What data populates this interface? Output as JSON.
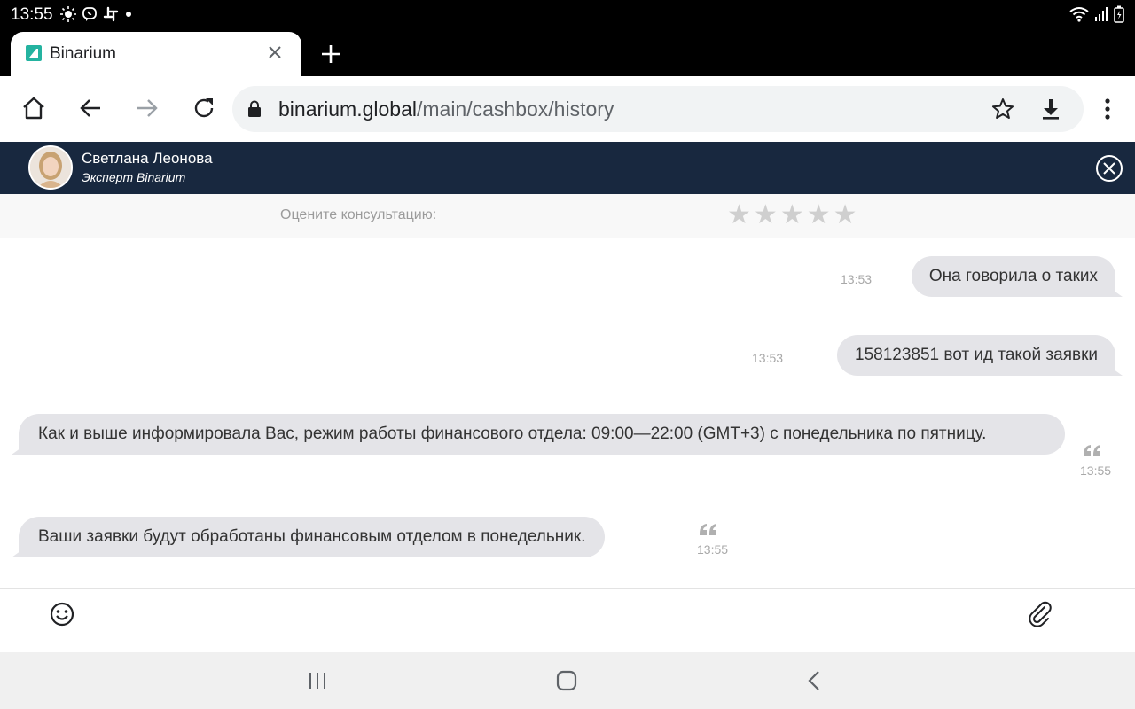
{
  "status_bar": {
    "time": "13:55",
    "icons": [
      "brightness-icon",
      "viber-icon",
      "slack-icon",
      "dot-icon"
    ],
    "right_icons": [
      "wifi-icon",
      "signal-icon",
      "battery-icon"
    ]
  },
  "browser": {
    "tab_title": "Binarium",
    "favicon_color": "#24b3a0",
    "url_host": "binarium.global",
    "url_path": "/main/cashbox/history"
  },
  "chat": {
    "agent_name": "Светлана Леонова",
    "agent_role": "Эксперт Binarium",
    "header_color": "#18283f",
    "rating_label": "Оцените консультацию:",
    "stars": [
      "★",
      "★",
      "★",
      "★",
      "★"
    ],
    "messages": [
      {
        "direction": "out",
        "text": "Она говорила о таких",
        "time": "13:53"
      },
      {
        "direction": "out",
        "text": "158123851 вот ид такой заявки",
        "time": "13:53"
      },
      {
        "direction": "in",
        "text": "Как и выше информировала Вас, режим работы финансового отдела: 09:00—22:00 (GMT+3) с понедельника по пятницу.",
        "time": "13:55"
      },
      {
        "direction": "in",
        "text": "Ваши заявки будут обработаны финансовым отделом в понедельник.",
        "time": "13:55"
      }
    ]
  }
}
